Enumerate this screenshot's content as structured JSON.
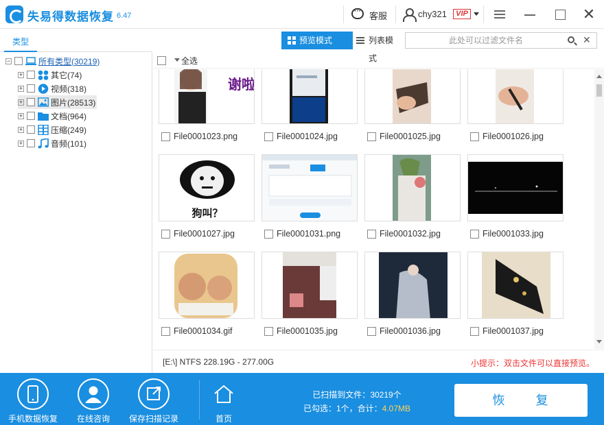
{
  "app": {
    "title": "失易得数据恢复",
    "version": "6.47"
  },
  "titlebar": {
    "service_label": "客服",
    "username": "chy321",
    "vip_badge": "VIP"
  },
  "left_panel": {
    "tab_label": "类型"
  },
  "tree": {
    "root": {
      "label": "所有类型(30219)",
      "icon": "computer-icon"
    },
    "items": [
      {
        "label": "其它(74)",
        "icon": "other-icon",
        "color": "#1a8ee0"
      },
      {
        "label": "视频(318)",
        "icon": "video-icon",
        "color": "#1a8ee0"
      },
      {
        "label": "图片(28513)",
        "icon": "picture-icon",
        "color": "#1a8ee0"
      },
      {
        "label": "文档(964)",
        "icon": "document-icon",
        "color": "#1a8ee0"
      },
      {
        "label": "压缩(249)",
        "icon": "archive-icon",
        "color": "#1a8ee0"
      },
      {
        "label": "音频(101)",
        "icon": "audio-icon",
        "color": "#1a8ee0"
      }
    ]
  },
  "toolbar": {
    "preview_mode": "预览模式",
    "list_mode": "列表模式",
    "filter_placeholder": "此处可以过滤文件名",
    "select_all": "全选"
  },
  "cards": [
    {
      "name": "File0001023.png",
      "thumb_text": "谢啦"
    },
    {
      "name": "File0001024.jpg"
    },
    {
      "name": "File0001025.jpg"
    },
    {
      "name": "File0001026.jpg"
    },
    {
      "name": "File0001027.jpg",
      "thumb_text": "狗叫？"
    },
    {
      "name": "File0001031.png"
    },
    {
      "name": "File0001032.jpg"
    },
    {
      "name": "File0001033.jpg"
    },
    {
      "name": "File0001034.gif"
    },
    {
      "name": "File0001035.jpg"
    },
    {
      "name": "File0001036.jpg"
    },
    {
      "name": "File0001037.jpg"
    }
  ],
  "status": {
    "disk": "[E:\\] NTFS 228.19G - 277.00G",
    "tip": "小提示：双击文件可以直接预览。"
  },
  "footer": {
    "phone_recovery": "手机数据恢复",
    "online_consult": "在线咨询",
    "save_scan": "保存扫描记录",
    "home": "首页",
    "scanned_label": "已扫描到文件：",
    "scanned_count": "30219个",
    "selected_label": "已勾选：",
    "selected_count": "1个",
    "total_label": "，合计：",
    "total_size": "4.07MB",
    "recover_button": "恢 复"
  },
  "colors": {
    "accent": "#1a8ee0",
    "tip": "#e33333",
    "highlight": "#ffd35a"
  }
}
